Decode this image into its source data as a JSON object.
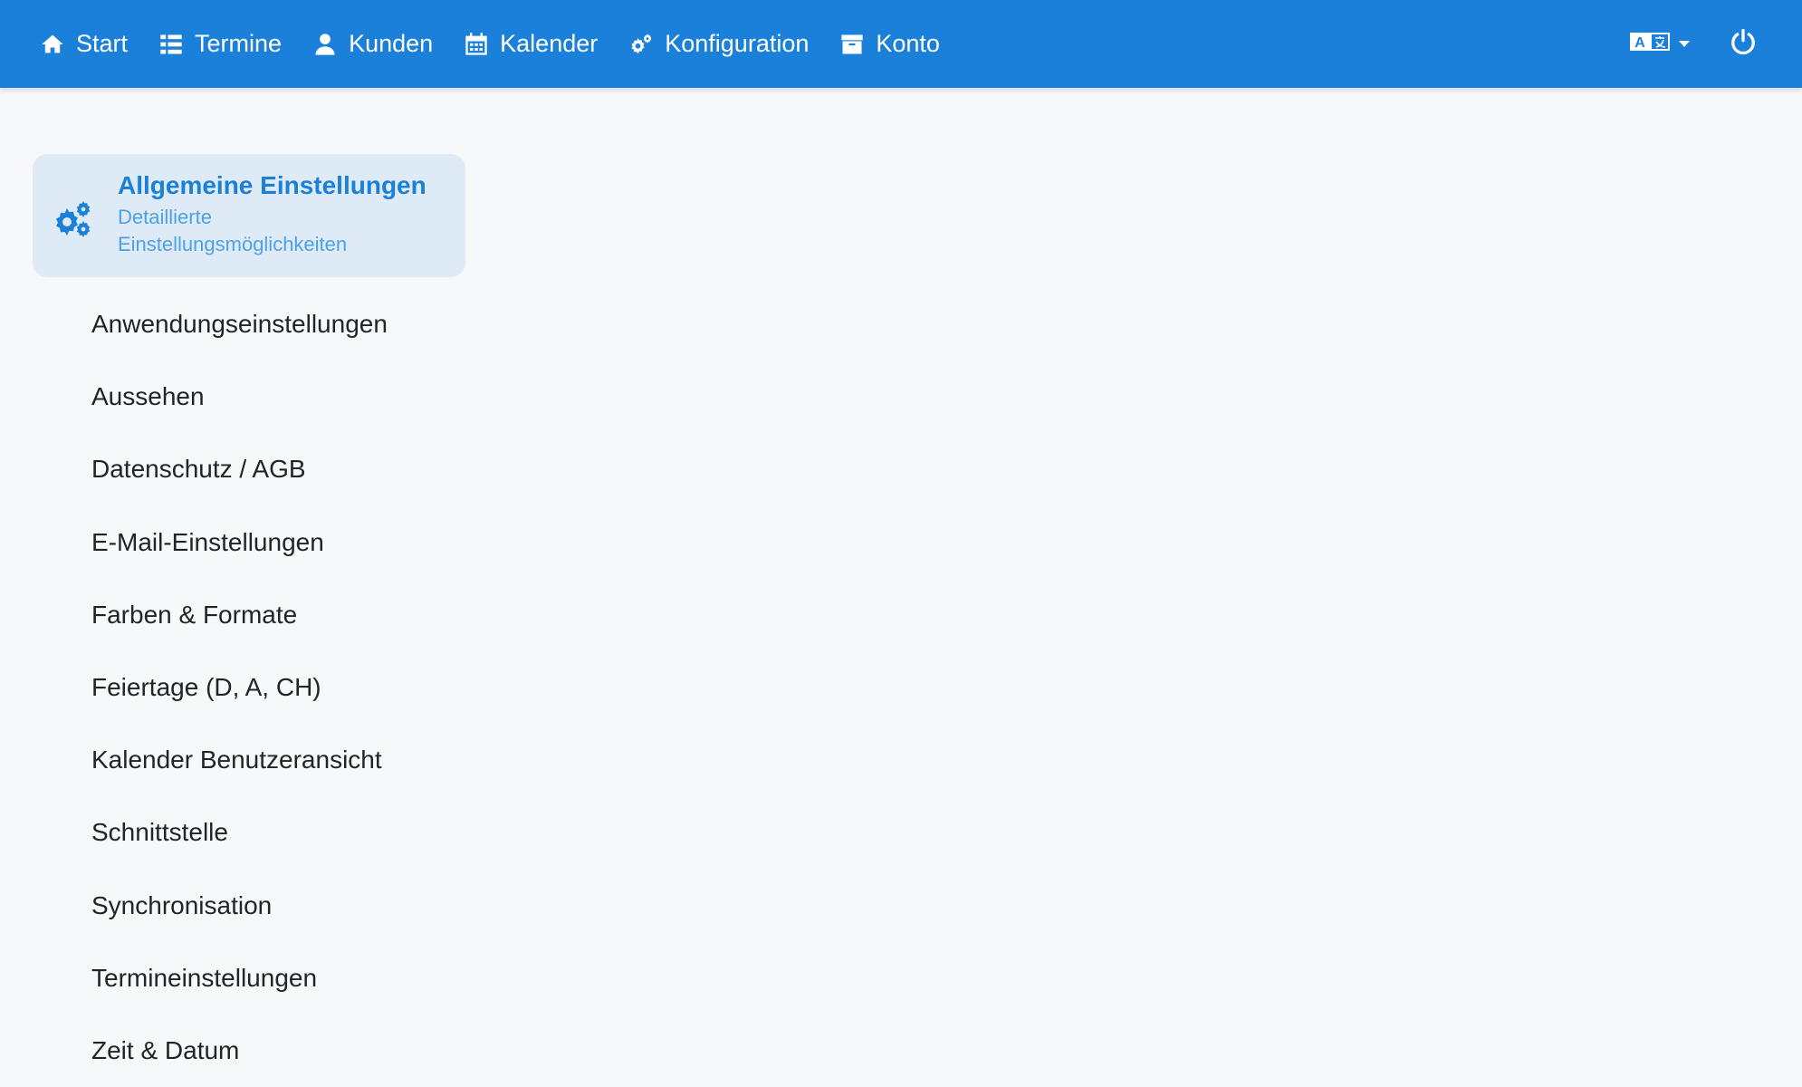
{
  "nav": {
    "items": [
      {
        "label": "Start",
        "icon": "home-icon"
      },
      {
        "label": "Termine",
        "icon": "list-icon"
      },
      {
        "label": "Kunden",
        "icon": "user-icon"
      },
      {
        "label": "Kalender",
        "icon": "calendar-icon"
      },
      {
        "label": "Konfiguration",
        "icon": "gears-icon"
      },
      {
        "label": "Konto",
        "icon": "archive-icon"
      }
    ],
    "language_icon": "language-icon",
    "power_icon": "power-icon"
  },
  "sidebar": {
    "active": {
      "title": "Allgemeine Einstellungen",
      "subtitle": "Detaillierte Einstellungsmöglichkeiten",
      "icon": "gears-icon"
    },
    "items": [
      {
        "label": "Anwendungseinstellungen"
      },
      {
        "label": "Aussehen"
      },
      {
        "label": "Datenschutz / AGB"
      },
      {
        "label": "E-Mail-Einstellungen"
      },
      {
        "label": "Farben & Formate"
      },
      {
        "label": "Feiertage (D, A, CH)"
      },
      {
        "label": "Kalender Benutzeransicht"
      },
      {
        "label": "Schnittstelle"
      },
      {
        "label": "Synchronisation"
      },
      {
        "label": "Termineinstellungen"
      },
      {
        "label": "Zeit & Datum"
      }
    ]
  },
  "colors": {
    "navbar": "#1a80d9",
    "background": "#f7f8fa",
    "active_card": "#deebf6",
    "accent": "#1a80d9"
  }
}
